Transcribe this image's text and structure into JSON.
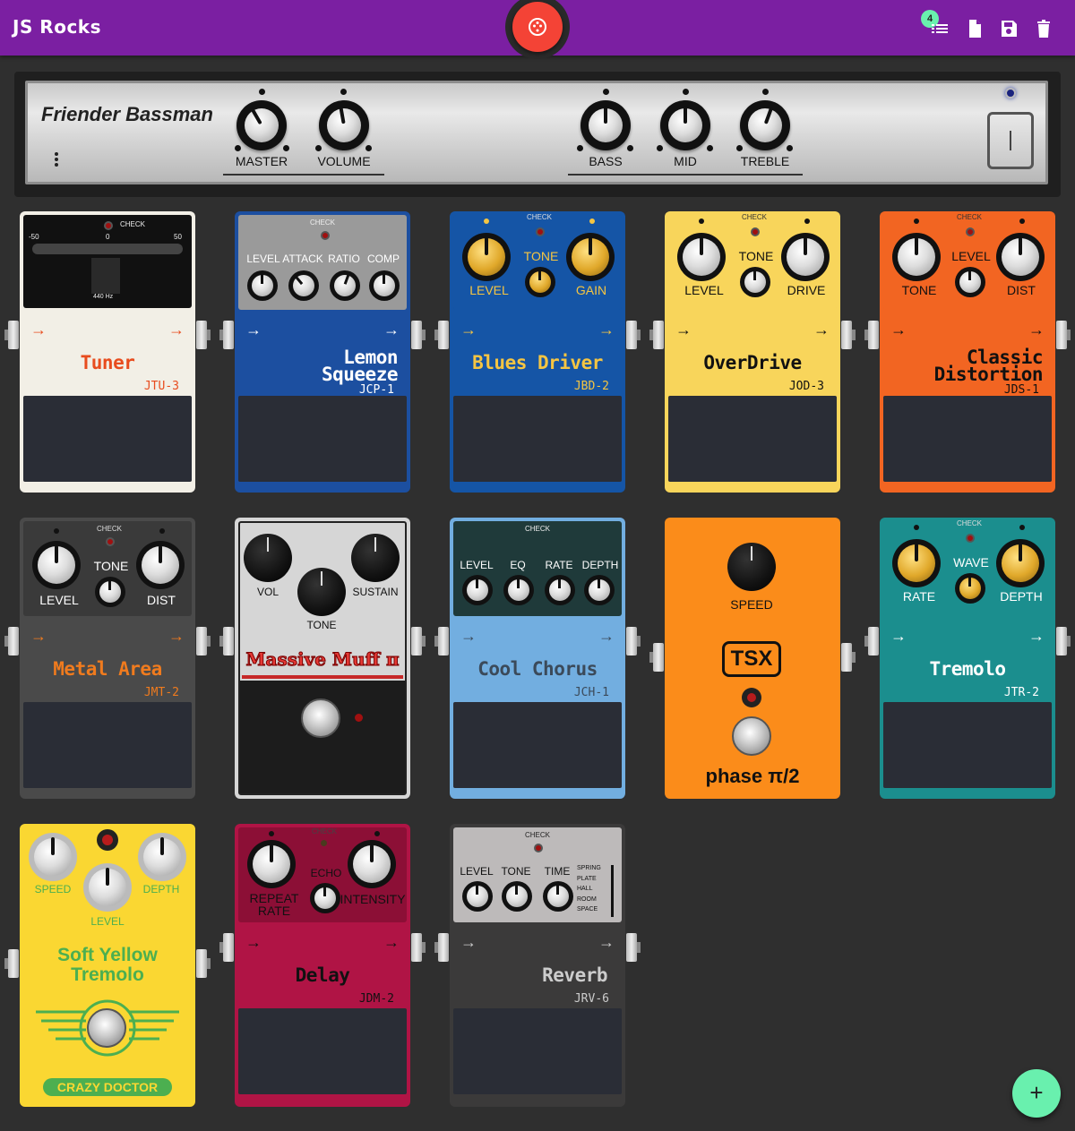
{
  "app": {
    "title": "JS Rocks"
  },
  "toolbar": {
    "badge_count": "4",
    "icons": [
      "list-icon",
      "new-file-icon",
      "save-icon",
      "delete-icon"
    ]
  },
  "amp": {
    "name": "Friender Bassman",
    "knobs": [
      "MASTER",
      "VOLUME",
      "BASS",
      "MID",
      "TREBLE"
    ]
  },
  "pedals": {
    "tuner": {
      "name": "Tuner",
      "model": "JTU-3",
      "check": "CHECK",
      "scale_min": "-50",
      "scale_mid": "0",
      "scale_max": "50",
      "freq": "440 Hz",
      "color": "#f2efe6"
    },
    "lemon": {
      "name_1": "Lemon",
      "name_2": "Squeeze",
      "model": "JCP-1",
      "check": "CHECK",
      "knobs": [
        "LEVEL",
        "ATTACK",
        "RATIO",
        "COMP"
      ],
      "color": "#1c4fa0"
    },
    "blues": {
      "name": "Blues Driver",
      "model": "JBD-2",
      "check": "CHECK",
      "knobs": [
        "LEVEL",
        "TONE",
        "GAIN"
      ],
      "color": "#1555a6"
    },
    "overdrive": {
      "name": "OverDrive",
      "model": "JOD-3",
      "check": "CHECK",
      "knobs": [
        "LEVEL",
        "TONE",
        "DRIVE"
      ],
      "color": "#f8d55b"
    },
    "distortion": {
      "name_1": "Classic",
      "name_2": "Distortion",
      "model": "JDS-1",
      "check": "CHECK",
      "knobs": [
        "TONE",
        "LEVEL",
        "DIST"
      ],
      "color": "#f26522"
    },
    "metal": {
      "name": "Metal Area",
      "model": "JMT-2",
      "check": "CHECK",
      "knobs": [
        "LEVEL",
        "TONE",
        "DIST"
      ],
      "color": "#4a4a4a"
    },
    "muff": {
      "name": "Massive Muff π",
      "knobs": [
        "VOL",
        "TONE",
        "SUSTAIN"
      ],
      "color": "#d6d6d6"
    },
    "chorus": {
      "name": "Cool Chorus",
      "model": "JCH-1",
      "check": "CHECK",
      "knobs": [
        "LEVEL",
        "EQ",
        "RATE",
        "DEPTH"
      ],
      "color": "#72aee0"
    },
    "phaser": {
      "knob": "SPEED",
      "brand": "TSX",
      "name": "phase π/2",
      "color": "#fb8c1a"
    },
    "tremolo": {
      "name": "Tremolo",
      "model": "JTR-2",
      "check": "CHECK",
      "knobs": [
        "RATE",
        "WAVE",
        "DEPTH"
      ],
      "color": "#1b8e8e"
    },
    "softyellow": {
      "name_1": "Soft Yellow",
      "name_2": "Tremolo",
      "brand": "CRAZY DOCTOR",
      "knobs": [
        "SPEED",
        "LEVEL",
        "DEPTH"
      ],
      "color": "#fad732"
    },
    "delay": {
      "name": "Delay",
      "model": "JDM-2",
      "check": "CHECK",
      "knobs": [
        "REPEAT RATE",
        "ECHO",
        "INTENSITY"
      ],
      "color": "#b01445"
    },
    "reverb": {
      "name": "Reverb",
      "model": "JRV-6",
      "check": "CHECK",
      "knobs": [
        "LEVEL",
        "TONE",
        "TIME"
      ],
      "modes": [
        "SPRING",
        "PLATE",
        "HALL",
        "ROOM",
        "SPACE"
      ],
      "color": "#3b3a3a"
    }
  },
  "fab": {
    "label": "+"
  }
}
